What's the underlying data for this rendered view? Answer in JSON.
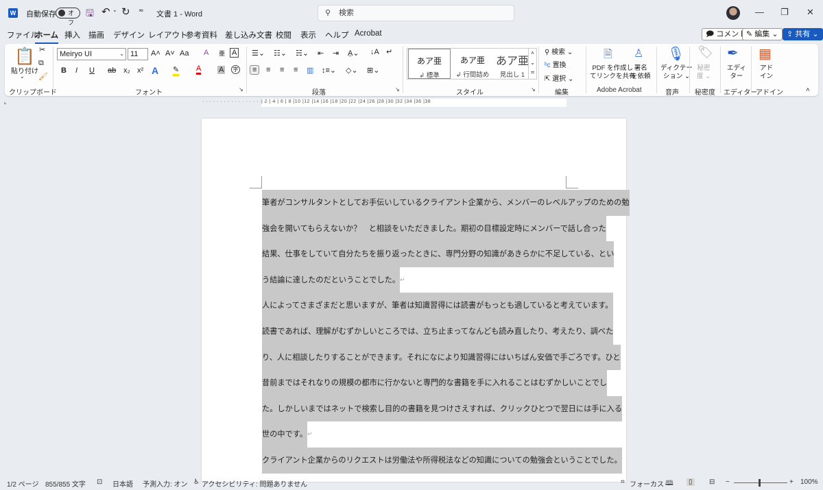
{
  "titlebar": {
    "app_icon": "W",
    "autosave_label": "自動保存",
    "autosave_state": "オフ",
    "doc_title": "文書 1 - Word",
    "search_placeholder": "検索",
    "minimize": "—",
    "restore": "❐",
    "close": "✕"
  },
  "tabs": [
    "ファイル",
    "ホーム",
    "挿入",
    "描画",
    "デザイン",
    "レイアウト",
    "参考資料",
    "差し込み文書",
    "校閲",
    "表示",
    "ヘルプ",
    "Acrobat"
  ],
  "active_tab": "ホーム",
  "top_buttons": {
    "comment": "コメント",
    "edit": "編集",
    "share": "共有"
  },
  "ribbon": {
    "clipboard": {
      "paste": "貼り付け",
      "label": "クリップボード"
    },
    "font": {
      "name": "Meiryo UI",
      "size": "11",
      "label": "フォント",
      "case": "Aa",
      "bold": "B",
      "italic": "I",
      "underline": "U",
      "strike": "ab",
      "sub": "x₂",
      "sup": "x²"
    },
    "paragraph": {
      "label": "段落"
    },
    "styles": {
      "label": "スタイル",
      "items": [
        {
          "preview": "あア亜",
          "name": "↲ 標準"
        },
        {
          "preview": "あア亜",
          "name": "↲ 行間詰め"
        },
        {
          "preview": "あア亜",
          "name": "見出し 1"
        }
      ]
    },
    "editing": {
      "label": "編集",
      "find": "検索",
      "replace": "置換",
      "select": "選択"
    },
    "acrobat": {
      "label": "Adobe Acrobat",
      "pdf": "PDF を作成し",
      "pdf2": "てリンクを共有",
      "sign": "署名",
      "sign2": "を依頼"
    },
    "voice": {
      "label": "音声",
      "dictate": "ディクテー",
      "dictate2": "ション"
    },
    "sensitivity": {
      "label": "秘密度",
      "btn": "秘密",
      "btn2": "度"
    },
    "editor": {
      "label": "エディター",
      "btn": "エディ",
      "btn2": "ター"
    },
    "addins": {
      "label": "アドイン",
      "btn": "アド",
      "btn2": "イン"
    }
  },
  "ruler": "| 2 | 4 | 6 | 8 |10 |12 |14 |16 |18 |20 |22 |24 |26 |28 |30 |32 |34 |36 |38",
  "document": {
    "lines": [
      "筆者がコンサルタントとしてお手伝いしているクライアント企業から、メンバーのレベルアップのための勉",
      "強会を開いてもらえないか？　と相談をいただきました。期初の目標設定時にメンバーで話し合った",
      "結果、仕事をしていて自分たちを振り返ったときに、専門分野の知識があきらかに不足している、とい",
      "う結論に達したのだということでした。",
      "人によってさまざまだと思いますが、筆者は知識習得には読書がもっとも適していると考えています。",
      "読書であれば、理解がむずかしいところでは、立ち止まってなんども読み直したり、考えたり、調べた",
      "り、人に相談したりすることができます。それになにより知識習得にはいちばん安価で手ごろです。ひと",
      "昔前まではそれなりの規模の都市に行かないと専門的な書籍を手に入れることはむずかしいことでし",
      "た。しかしいまではネットで検索し目的の書籍を見つけさえすれば、クリックひとつで翌日には手に入る",
      "世の中です。",
      "クライアント企業からのリクエストは労働法や所得税法などの知識についての勉強会ということでした。"
    ],
    "paragraph_mark": "↵"
  },
  "status": {
    "page": "1/2 ページ",
    "words": "855/855 文字",
    "language": "日本語",
    "predict": "予測入力: オン",
    "accessibility": "アクセシビリティ: 問題ありません",
    "focus": "フォーカス",
    "zoom": "100%",
    "zoom_level_percent": 100
  }
}
